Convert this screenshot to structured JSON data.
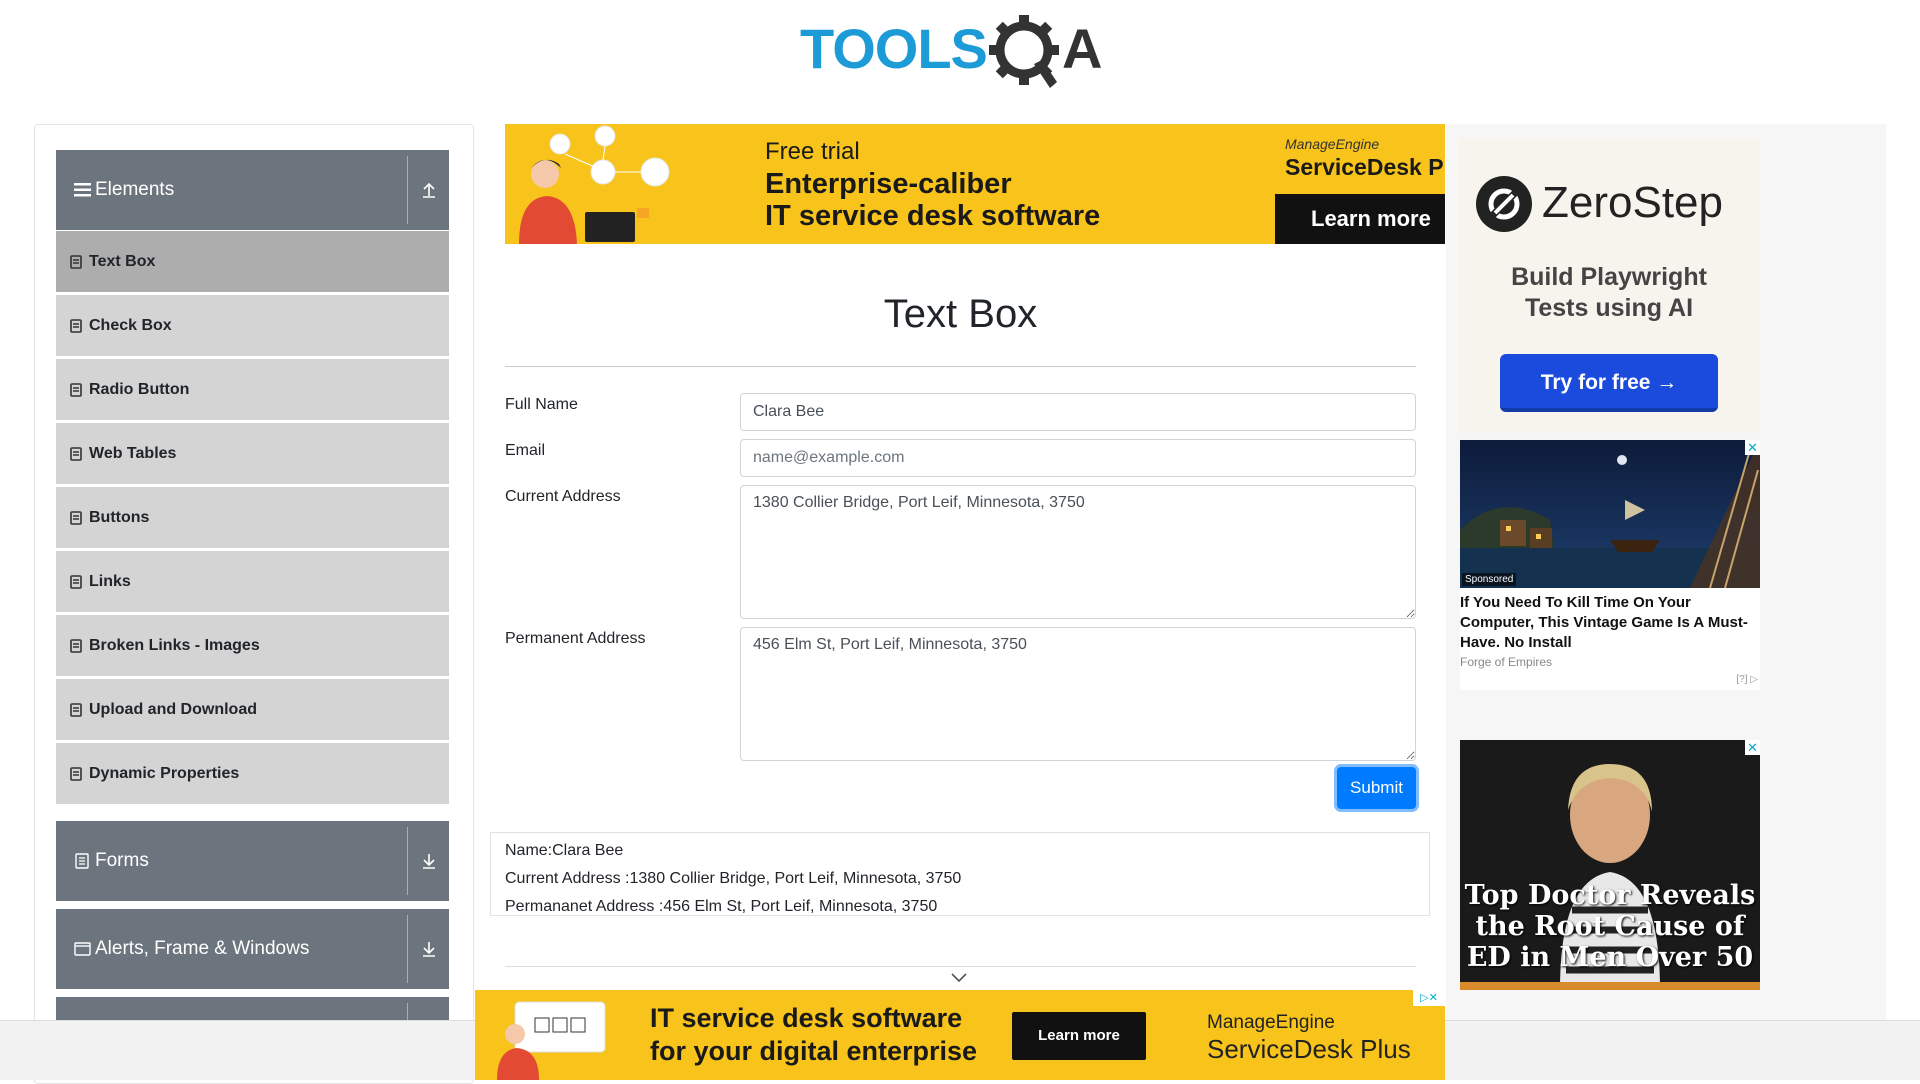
{
  "logo": {
    "text_left": "TOOLS",
    "text_right": "A",
    "colors": {
      "blue": "#1C9BD7",
      "dark": "#333333"
    }
  },
  "sidebar": {
    "groups": [
      {
        "label": "Elements",
        "icon": "hamburger-icon",
        "toggle_icon": "arrow-up-icon",
        "expanded": true
      },
      {
        "label": "Forms",
        "icon": "document-icon",
        "toggle_icon": "arrow-down-icon",
        "expanded": false
      },
      {
        "label": "Alerts, Frame & Windows",
        "icon": "window-icon",
        "toggle_icon": "arrow-down-icon",
        "expanded": false
      }
    ],
    "items": [
      {
        "label": "Text Box",
        "active": true
      },
      {
        "label": "Check Box"
      },
      {
        "label": "Radio Button"
      },
      {
        "label": "Web Tables"
      },
      {
        "label": "Buttons"
      },
      {
        "label": "Links"
      },
      {
        "label": "Broken Links - Images"
      },
      {
        "label": "Upload and Download"
      },
      {
        "label": "Dynamic Properties"
      }
    ]
  },
  "ad_top": {
    "line1": "Free trial",
    "line2": "Enterprise-caliber",
    "line3": "IT service desk software",
    "brand_small": "ManageEngine",
    "brand": "ServiceDesk Plu",
    "cta": "Learn more",
    "color": "#F8C41B"
  },
  "form": {
    "title": "Text Box",
    "full_name_label": "Full Name",
    "full_name_value": "Clara Bee",
    "email_label": "Email",
    "email_placeholder": "name@example.com",
    "current_address_label": "Current Address",
    "current_address_value": "1380 Collier Bridge, Port Leif, Minnesota, 3750",
    "permanent_address_label": "Permanent Address",
    "permanent_address_value": "456 Elm St, Port Leif, Minnesota, 3750",
    "submit_label": "Submit",
    "accent": "#007BFF"
  },
  "output": {
    "name": "Name:Clara Bee",
    "current_address": "Current Address :1380 Collier Bridge, Port Leif, Minnesota, 3750",
    "permanent_address": "Permananet Address :456 Elm St, Port Leif, Minnesota, 3750"
  },
  "ad_zerostep": {
    "name": "ZeroStep",
    "tagline_1": "Build Playwright",
    "tagline_2": "Tests using AI",
    "cta": "Try for free →"
  },
  "ad_ship": {
    "sponsored": "Sponsored",
    "headline": "If You Need To Kill Time On Your Computer, This Vintage Game Is A Must-Have. No Install",
    "source": "Forge of Empires",
    "choices": "[?]"
  },
  "ad_doctor": {
    "headline": "Top Doctor Reveals the Root Cause of ED in Men Over 50"
  },
  "ad_bottom": {
    "line1": "IT service desk software",
    "line2": "for your digital enterprise",
    "cta": "Learn more",
    "brand_small": "ManageEngine",
    "brand": "ServiceDesk Plus"
  }
}
